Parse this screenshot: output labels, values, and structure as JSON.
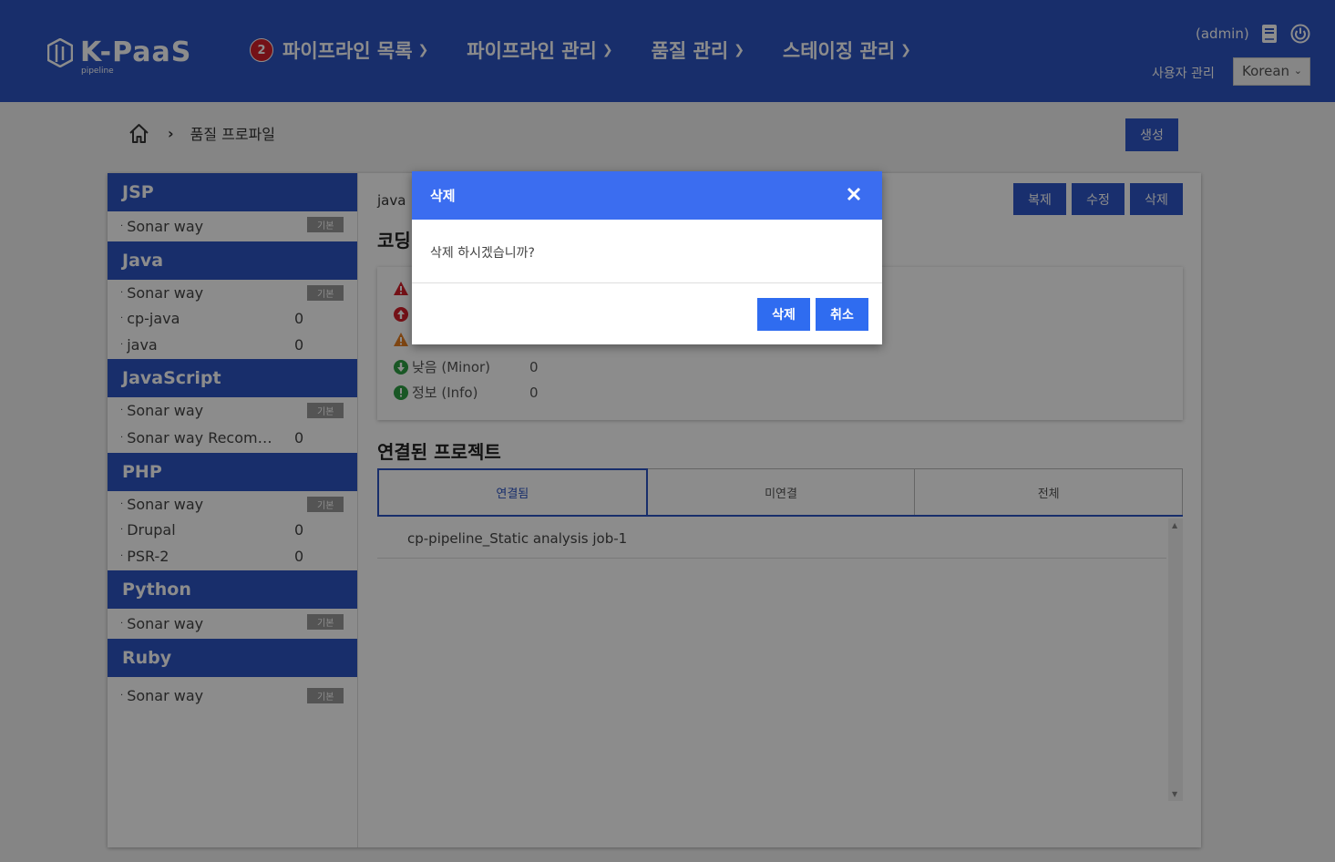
{
  "header": {
    "logo_text": "K-PaaS",
    "logo_sub": "pipeline",
    "nav": [
      {
        "label": "파이프라인 목록",
        "badge": "2"
      },
      {
        "label": "파이프라인 관리"
      },
      {
        "label": "품질 관리"
      },
      {
        "label": "스테이징 관리"
      }
    ],
    "user": "(admin)",
    "user_mgmt": "사용자 관리",
    "language": "Korean"
  },
  "breadcrumb": {
    "title": "품질 프로파일"
  },
  "create_label": "생성",
  "sidebar": {
    "categories": [
      {
        "name": "JSP",
        "profiles": [
          {
            "name": "Sonar way",
            "tag": "기본"
          }
        ]
      },
      {
        "name": "Java",
        "profiles": [
          {
            "name": "Sonar way",
            "tag": "기본"
          },
          {
            "name": "cp-java",
            "count": "0"
          },
          {
            "name": "java",
            "count": "0"
          }
        ]
      },
      {
        "name": "JavaScript",
        "profiles": [
          {
            "name": "Sonar way",
            "tag": "기본"
          },
          {
            "name": "Sonar way Recomme···",
            "count": "0"
          }
        ]
      },
      {
        "name": "PHP",
        "profiles": [
          {
            "name": "Sonar way",
            "tag": "기본"
          },
          {
            "name": "Drupal",
            "count": "0"
          },
          {
            "name": "PSR-2",
            "count": "0"
          }
        ]
      },
      {
        "name": "Python",
        "profiles": [
          {
            "name": "Sonar way",
            "tag": "기본"
          }
        ]
      },
      {
        "name": "Ruby",
        "profiles": [
          {
            "name": "Sonar way",
            "tag": "기본"
          }
        ]
      }
    ]
  },
  "content": {
    "language": "java",
    "coding_title": "코딩",
    "actions": {
      "copy": "복제",
      "edit": "수정",
      "delete": "삭제"
    },
    "severities": [
      {
        "label": "",
        "count": "",
        "icon": "blocker-icon",
        "color": "#d3202a"
      },
      {
        "label": "",
        "count": "",
        "icon": "critical-icon",
        "color": "#d3202a"
      },
      {
        "label": "",
        "count": "",
        "icon": "major-icon",
        "color": "#e67e22"
      },
      {
        "label": "낮음 (Minor)",
        "count": "0",
        "icon": "minor-icon",
        "color": "#2e9e44"
      },
      {
        "label": "정보 (Info)",
        "count": "0",
        "icon": "info-icon",
        "color": "#2e9e44"
      }
    ],
    "projects_title": "연결된 프로젝트",
    "tabs": [
      "연결됨",
      "미연결",
      "전체"
    ],
    "projects": [
      "cp-pipeline_Static analysis job-1"
    ]
  },
  "modal": {
    "title": "삭제",
    "message": "삭제 하시겠습니까?",
    "confirm": "삭제",
    "cancel": "취소"
  }
}
